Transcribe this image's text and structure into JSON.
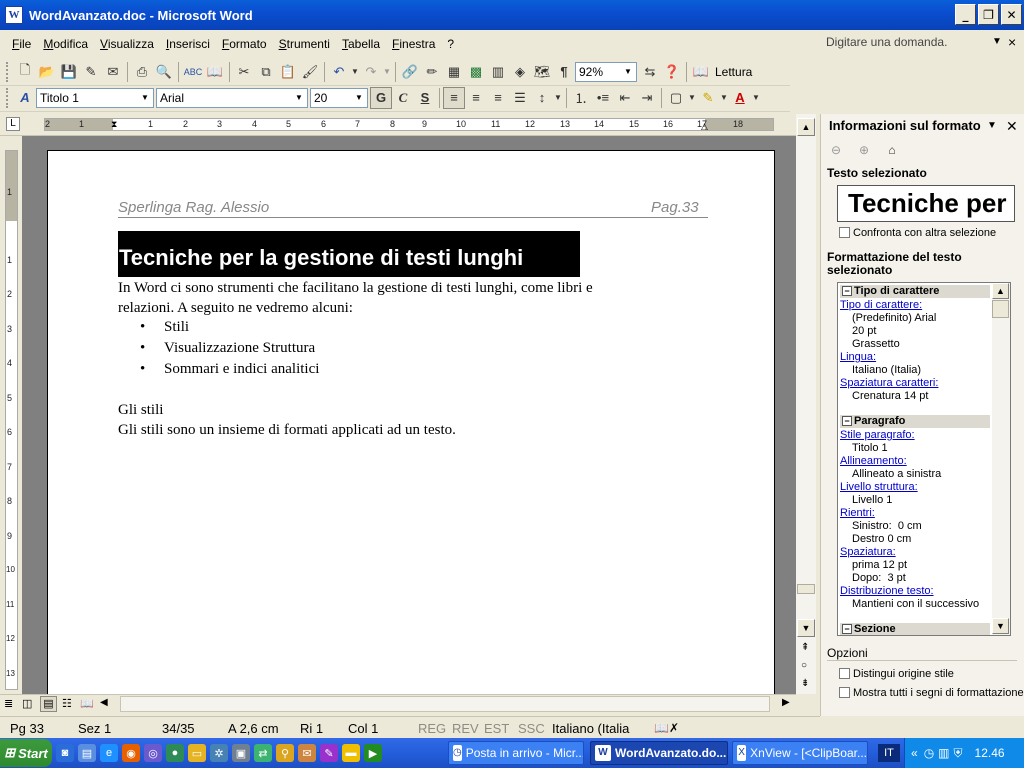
{
  "window": {
    "title": "WordAvanzato.doc - Microsoft Word",
    "app_icon": "W",
    "minimize": "_",
    "restore": "❐",
    "close": "✕"
  },
  "menu": {
    "items": [
      "File",
      "Modifica",
      "Visualizza",
      "Inserisci",
      "Formato",
      "Strumenti",
      "Tabella",
      "Finestra",
      "?"
    ],
    "ask_placeholder": "Digitare una domanda.",
    "doc_close": "×"
  },
  "standard_toolbar": {
    "zoom": "92%",
    "reading": "Lettura"
  },
  "format_toolbar": {
    "style": "Titolo 1",
    "font": "Arial",
    "size": "20",
    "bold": "G",
    "italic": "C",
    "underline": "S"
  },
  "ruler": {
    "numbers": [
      "2",
      "1",
      "1",
      "2",
      "3",
      "4",
      "5",
      "6",
      "7",
      "8",
      "9",
      "10",
      "11",
      "12",
      "13",
      "14",
      "15",
      "16",
      "17",
      "18"
    ]
  },
  "vruler": {
    "numbers": [
      "1",
      "1",
      "2",
      "3",
      "4",
      "5",
      "6",
      "7",
      "8",
      "9",
      "10",
      "11",
      "12",
      "13"
    ]
  },
  "document": {
    "header_left": "Sperlinga Rag. Alessio",
    "header_right": "Pag.33",
    "heading": "Tecniche per la gestione di testi lunghi",
    "para1_line1": "In Word ci sono strumenti che facilitano la gestione di testi lunghi, come libri e",
    "para1_line2": "relazioni. A seguito ne vedremo alcuni:",
    "bullets": [
      "Stili",
      "Visualizzazione Struttura",
      "Sommari e indici analitici"
    ],
    "subhead": "Gli stili",
    "para2": "Gli stili sono un insieme di formati applicati ad un testo."
  },
  "status": {
    "page": "Pg 33",
    "section": "Sez 1",
    "pages": "34/35",
    "at": "A 2,6 cm",
    "line": "Ri 1",
    "col": "Col 1",
    "rec": "REG",
    "trk": "REV",
    "ext": "EST",
    "ovr": "SSC",
    "language": "Italiano (Italia"
  },
  "taskpane": {
    "title": "Informazioni sul formato",
    "selected_label": "Testo selezionato",
    "preview": "Tecniche per",
    "compare": "Confronta con altra selezione",
    "formatting_label_1": "Formattazione del testo",
    "formatting_label_2": "selezionato",
    "font_section": "Tipo di carattere",
    "font_link": "Tipo di carattere:",
    "font_values": [
      "(Predefinito) Arial",
      "20 pt",
      "Grassetto"
    ],
    "lang_link": "Lingua:",
    "lang_value": "Italiano (Italia)",
    "spacing_link": "Spaziatura caratteri:",
    "spacing_value": "Crenatura 14 pt",
    "para_section": "Paragrafo",
    "style_link": "Stile paragrafo:",
    "style_value": "Titolo 1",
    "align_link": "Allineamento:",
    "align_value": "Allineato a sinistra",
    "outline_link": "Livello struttura:",
    "outline_value": "Livello 1",
    "indent_link": "Rientri:",
    "indent_values": [
      "Sinistro:  0 cm",
      "Destro 0 cm"
    ],
    "para_spacing_link": "Spaziatura:",
    "para_spacing_values": [
      "prima 12 pt",
      "Dopo:  3 pt"
    ],
    "flow_link": "Distribuzione testo:",
    "flow_value": "Mantieni con il successivo",
    "section_section": "Sezione",
    "options_label": "Opzioni",
    "opt1": "Distingui origine stile",
    "opt2": "Mostra tutti i segni di formattazione"
  },
  "taskbar": {
    "start": "Start",
    "tasks": [
      "Posta in arrivo - Micr...",
      "WordAvanzato.do...",
      "XnView - [<ClipBoar..."
    ],
    "lang": "IT",
    "time": "12.46"
  }
}
